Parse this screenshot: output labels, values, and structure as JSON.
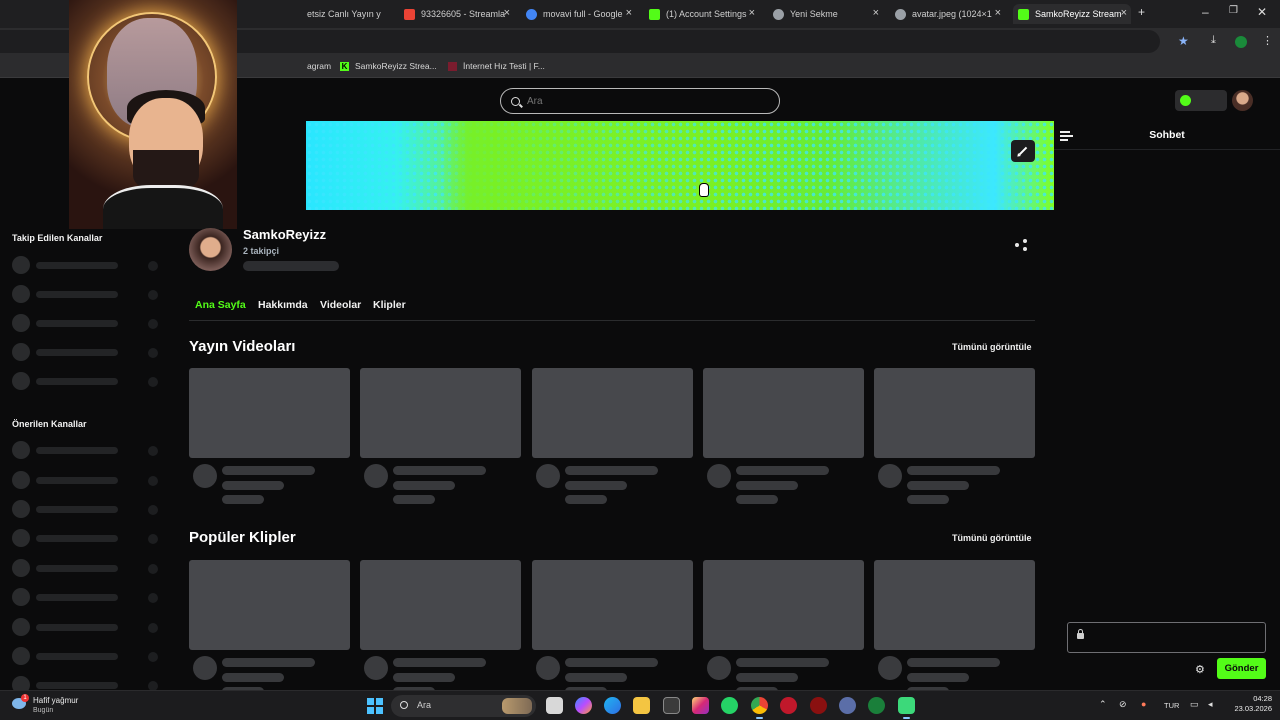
{
  "browser": {
    "tabs": [
      {
        "label": "etsiz Canlı Yayın y",
        "color": "#e63946"
      },
      {
        "label": "93326605 - Streamla",
        "color": "#ea4335"
      },
      {
        "label": "movavi full - Google",
        "color": "#4285f4"
      },
      {
        "label": "(1) Account Settings",
        "color": "#53fc18"
      },
      {
        "label": "Yeni Sekme",
        "color": "#9aa0a6"
      },
      {
        "label": "avatar.jpeg (1024×1",
        "color": "#9aa0a6"
      },
      {
        "label": "SamkoReyizz Stream",
        "color": "#53fc18"
      }
    ],
    "bookmarks": [
      {
        "label": "agram"
      },
      {
        "label": "SamkoReyizz Strea..."
      },
      {
        "label": "İnternet Hız Testi | F..."
      }
    ]
  },
  "header": {
    "search_placeholder": "Ara"
  },
  "sidebar": {
    "followed_title": "Takip Edilen Kanallar",
    "recommended_title": "Önerilen Kanallar"
  },
  "channel": {
    "name": "SamkoReyizz",
    "followers": "2 takipçi",
    "tabs": [
      "Ana Sayfa",
      "Hakkımda",
      "Videolar",
      "Klipler"
    ],
    "active_tab": "Ana Sayfa"
  },
  "sections": {
    "videos_title": "Yayın Videoları",
    "clips_title": "Popüler Klipler",
    "view_all": "Tümünü görüntüle"
  },
  "chat": {
    "title": "Sohbet",
    "send_label": "Gönder"
  },
  "taskbar": {
    "weather": "Hafif yağmur",
    "weather_sub": "Bugün",
    "weather_badge": "1",
    "search_placeholder": "Ara",
    "lang": "TUR",
    "time": "04:28",
    "date": "23.03.2026"
  },
  "colors": {
    "accent": "#53fc18",
    "background": "#0b0b0c"
  }
}
